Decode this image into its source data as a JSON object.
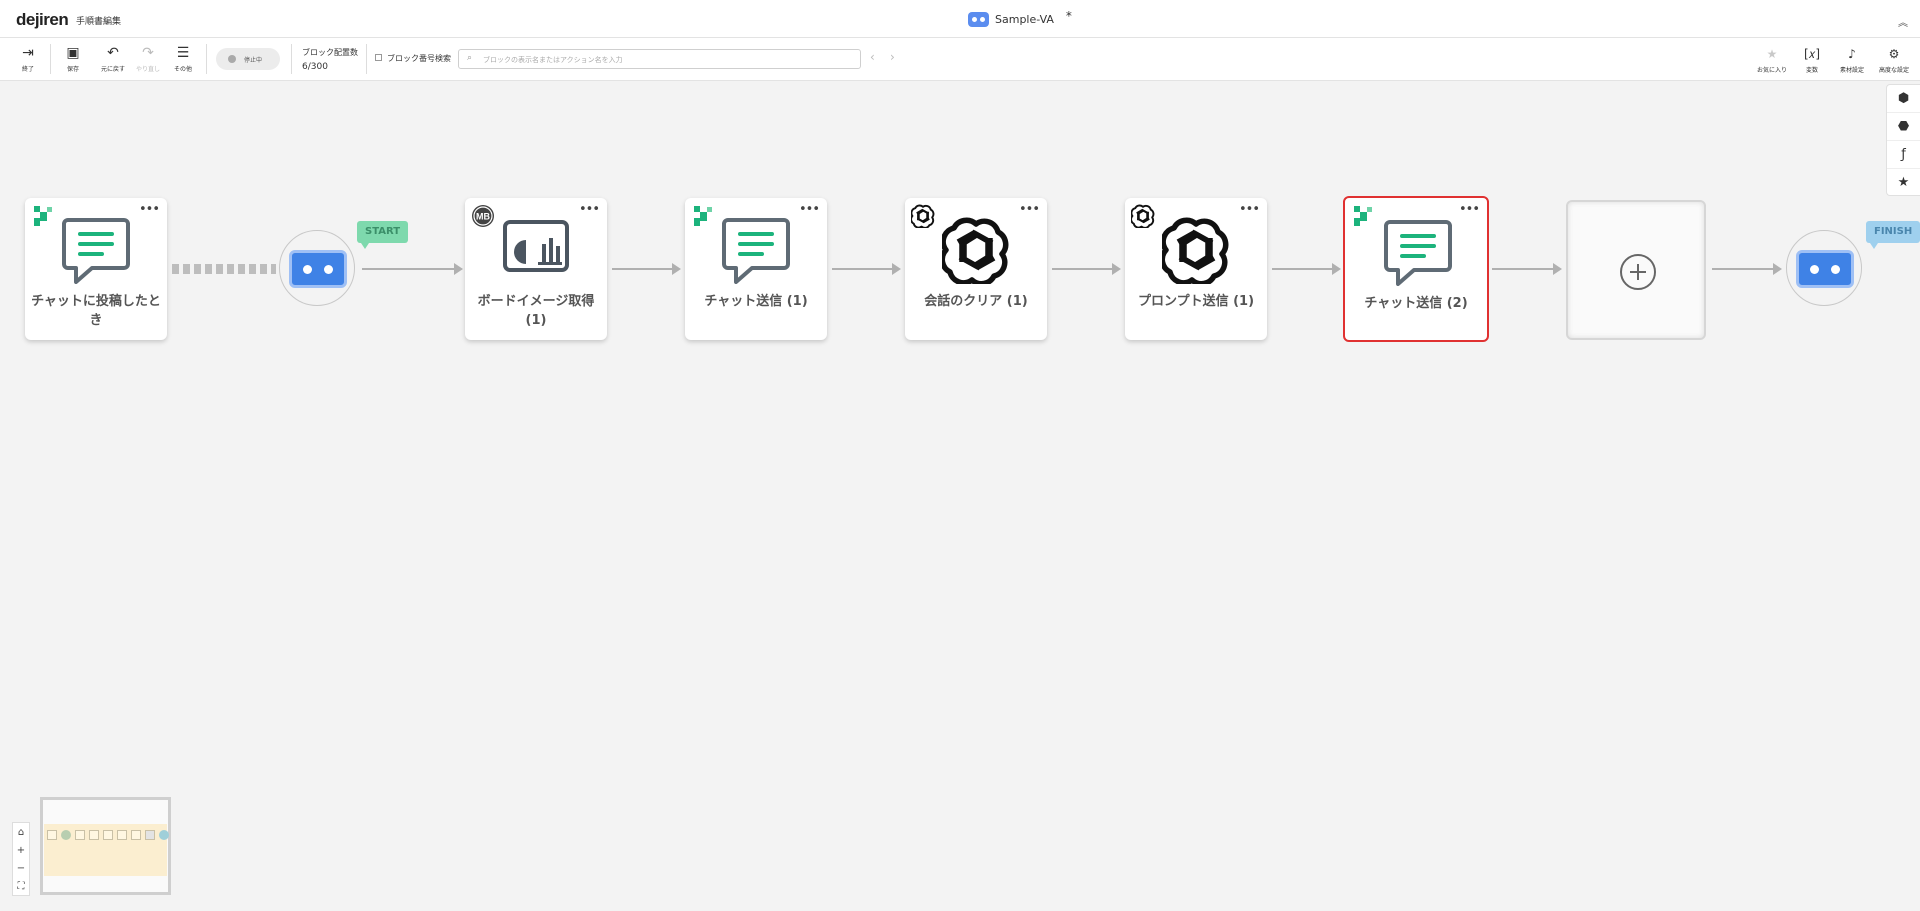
{
  "header": {
    "logo": "dejiren",
    "editor_title": "手順書編集",
    "doc_title": "Sample-VA",
    "unsaved_mark": "*",
    "collapse_icon": "chevron-double-up-icon"
  },
  "toolbar": {
    "exit_label": "終了",
    "save_label": "保存",
    "undo_label": "元に戻す",
    "redo_label": "やり直し",
    "more_label": "その他",
    "status_label": "停止中",
    "block_count_label": "ブロック配置数",
    "block_count_value": "6/300",
    "block_number_search_label": "ブロック番号検索",
    "search_placeholder": "ブロックの表示名またはアクション名を入力",
    "favorites_label": "お気に入り",
    "variables_label": "変数",
    "material_settings_label": "素材設定",
    "advanced_settings_label": "高度な設定"
  },
  "canvas": {
    "start_flag": "START",
    "finish_flag": "FINISH",
    "blocks": [
      {
        "title": "チャットに投稿したとき",
        "badge": "dejiren-icon",
        "icon": "chat-bubble-icon"
      },
      {
        "title": "ボードイメージ取得 (1)",
        "badge": "mb-icon",
        "icon": "dashboard-chart-icon"
      },
      {
        "title": "チャット送信 (1)",
        "badge": "dejiren-icon",
        "icon": "chat-bubble-icon"
      },
      {
        "title": "会話のクリア (1)",
        "badge": "openai-icon",
        "icon": "openai-icon"
      },
      {
        "title": "プロンプト送信 (1)",
        "badge": "openai-icon",
        "icon": "openai-icon"
      },
      {
        "title": "チャット送信 (2)",
        "badge": "dejiren-icon",
        "icon": "chat-bubble-icon",
        "selected": true
      }
    ]
  },
  "colors": {
    "accent_green": "#1cb37c",
    "bot_blue": "#3f82e6",
    "start_flag": "#7ed9ad",
    "finish_flag": "#9fd0ee",
    "selected_border": "#e03131"
  }
}
